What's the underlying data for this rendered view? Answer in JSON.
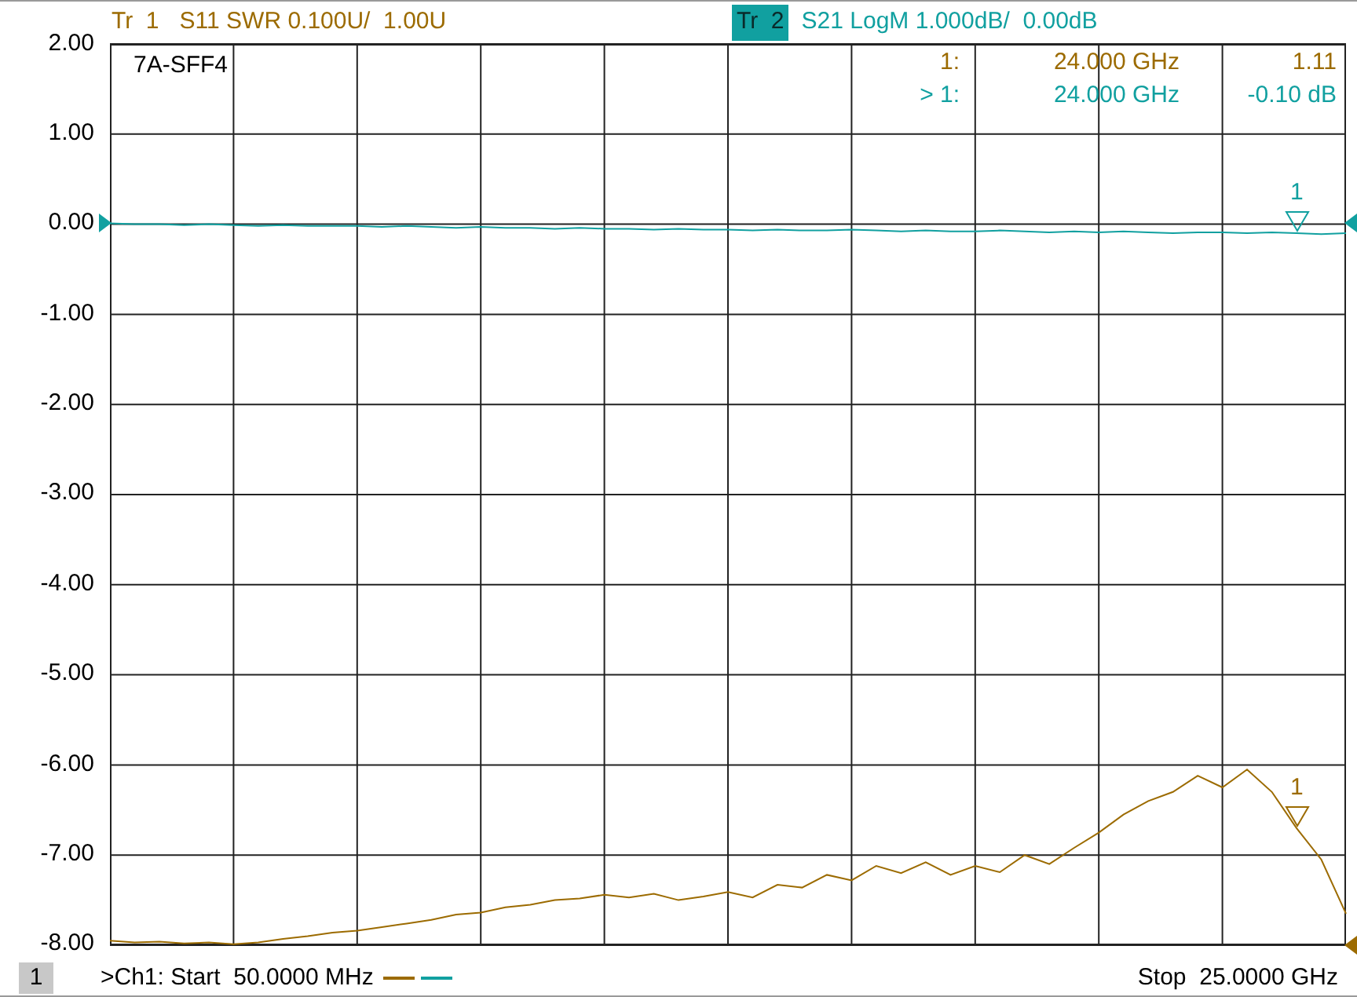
{
  "traces": [
    {
      "label": "Tr  1",
      "text": "S11 SWR 0.100U/  1.00U",
      "color": "#9c6b00",
      "selected": false
    },
    {
      "label": "Tr  2",
      "text": "S21 LogM 1.000dB/  0.00dB",
      "color": "#11a0a0",
      "selected": true
    }
  ],
  "plot": {
    "title": "7A-SFF4",
    "markers": [
      {
        "label": "1:",
        "frequency": "24.000 GHz",
        "value": "1.11",
        "color": "#9c6b00"
      },
      {
        "label": "> 1:",
        "frequency": "24.000 GHz",
        "value": "-0.10 dB",
        "color": "#11a0a0"
      }
    ],
    "trace_markers": [
      {
        "label": "1",
        "color": "#11a0a0"
      },
      {
        "label": "1",
        "color": "#9c6b00"
      }
    ],
    "chart_data": {
      "type": "line",
      "grid": true,
      "ylim": [
        -8,
        2
      ],
      "yticks": [
        {
          "value": 2,
          "label": "2.00"
        },
        {
          "value": 1,
          "label": "1.00"
        },
        {
          "value": 0,
          "label": "0.00"
        },
        {
          "value": -1,
          "label": "-1.00"
        },
        {
          "value": -2,
          "label": "-2.00"
        },
        {
          "value": -3,
          "label": "-3.00"
        },
        {
          "value": -4,
          "label": "-4.00"
        },
        {
          "value": -5,
          "label": "-5.00"
        },
        {
          "value": -6,
          "label": "-6.00"
        },
        {
          "value": -7,
          "label": "-7.00"
        },
        {
          "value": -8,
          "label": "-8.00"
        }
      ],
      "categories": [
        null,
        null,
        null,
        null,
        null,
        null,
        null,
        null,
        null,
        null,
        null,
        null,
        null,
        null,
        null,
        null,
        null,
        null,
        null,
        null,
        null,
        null,
        null,
        null,
        null,
        null,
        null,
        null,
        null,
        null,
        null,
        null,
        null,
        null,
        null,
        null,
        null,
        null,
        null,
        null,
        null,
        null,
        null,
        null,
        null,
        null,
        null,
        null,
        null,
        null,
        null
      ],
      "series": [
        {
          "color": "#11a0a0",
          "values": [
            0.01,
            0.0,
            0.0,
            -0.01,
            0.0,
            -0.01,
            -0.02,
            -0.01,
            -0.02,
            -0.02,
            -0.02,
            -0.03,
            -0.02,
            -0.03,
            -0.04,
            -0.03,
            -0.04,
            -0.04,
            -0.05,
            -0.04,
            -0.05,
            -0.05,
            -0.06,
            -0.05,
            -0.06,
            -0.06,
            -0.07,
            -0.06,
            -0.07,
            -0.07,
            -0.06,
            -0.07,
            -0.08,
            -0.07,
            -0.08,
            -0.08,
            -0.07,
            -0.08,
            -0.09,
            -0.08,
            -0.09,
            -0.08,
            -0.09,
            -0.1,
            -0.09,
            -0.09,
            -0.1,
            -0.09,
            -0.1,
            -0.11,
            -0.1
          ]
        },
        {
          "color": "#9c6b00",
          "values": [
            -7.95,
            -7.97,
            -7.96,
            -7.98,
            -7.97,
            -7.99,
            -7.97,
            -7.93,
            -7.9,
            -7.86,
            -7.84,
            -7.8,
            -7.76,
            -7.72,
            -7.66,
            -7.64,
            -7.58,
            -7.55,
            -7.5,
            -7.48,
            -7.44,
            -7.47,
            -7.43,
            -7.5,
            -7.46,
            -7.41,
            -7.47,
            -7.33,
            -7.36,
            -7.22,
            -7.28,
            -7.12,
            -7.2,
            -7.08,
            -7.22,
            -7.12,
            -7.19,
            -7.0,
            -7.1,
            -6.92,
            -6.75,
            -6.55,
            -6.4,
            -6.3,
            -6.12,
            -6.25,
            -6.05,
            -6.3,
            -6.7,
            -7.05,
            -7.65
          ]
        }
      ]
    }
  },
  "footer": {
    "channel": "1",
    "start": ">Ch1: Start  50.0000 MHz",
    "stop": "Stop  25.0000 GHz"
  }
}
